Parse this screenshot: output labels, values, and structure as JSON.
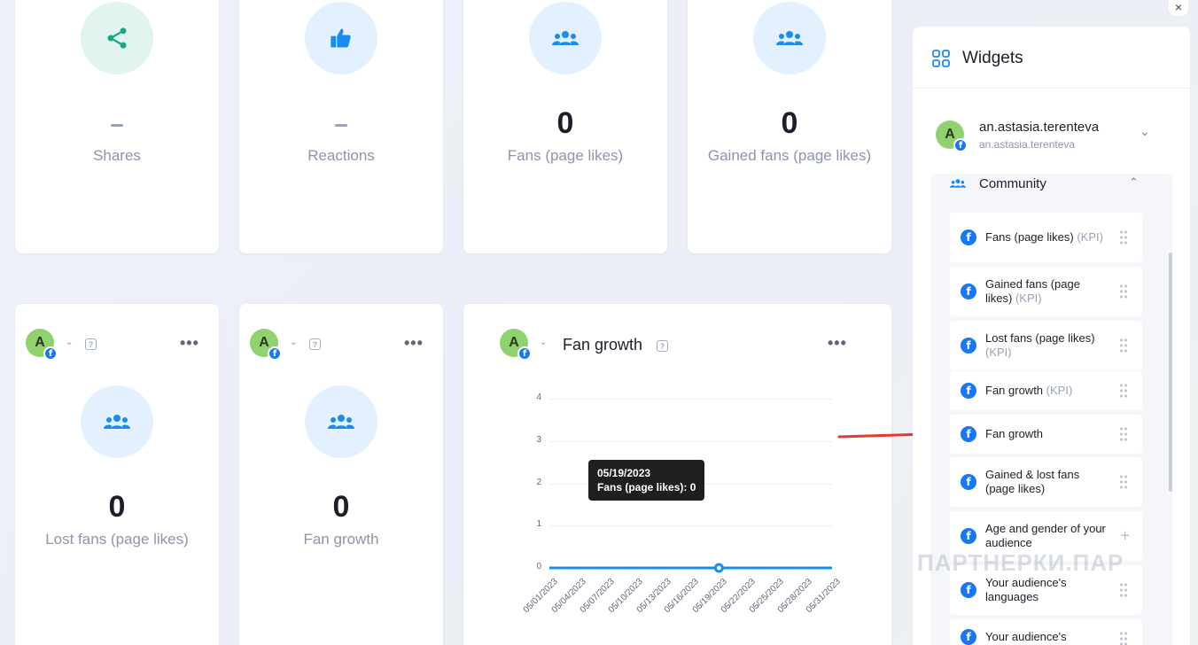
{
  "top_cards": [
    {
      "value": "",
      "label": "Shares",
      "icon": "share-icon",
      "empty": true
    },
    {
      "value": "",
      "label": "Reactions",
      "icon": "thumbs-up-icon",
      "empty": true
    },
    {
      "value": "0",
      "label": "Fans (page likes)",
      "icon": "users-icon",
      "empty": false
    },
    {
      "value": "0",
      "label": "Gained fans (page likes)",
      "icon": "users-icon",
      "empty": false
    }
  ],
  "bottom_cards": [
    {
      "avatar": "A",
      "value": "0",
      "label": "Lost fans (page likes)"
    },
    {
      "avatar": "A",
      "value": "0",
      "label": "Fan growth"
    }
  ],
  "chart_card": {
    "avatar": "A",
    "title": "Fan growth",
    "tooltip": {
      "date": "05/19/2023",
      "text": "Fans (page likes): 0"
    }
  },
  "chart_data": {
    "type": "line",
    "title": "Fan growth",
    "xlabel": "",
    "ylabel": "",
    "ylim": [
      0,
      4
    ],
    "y_ticks": [
      "4",
      "3",
      "2",
      "1",
      "0"
    ],
    "x_ticks": [
      "05/01/2023",
      "05/04/2023",
      "05/07/2023",
      "05/10/2023",
      "05/13/2023",
      "05/16/2023",
      "05/19/2023",
      "05/22/2023",
      "05/25/2023",
      "05/28/2023",
      "05/31/2023"
    ],
    "series": [
      {
        "name": "Fans (page likes)",
        "color": "#1a8cf0",
        "values": [
          0,
          0,
          0,
          0,
          0,
          0,
          0,
          0,
          0,
          0,
          0
        ]
      }
    ],
    "highlight": {
      "x": "05/19/2023",
      "y": 0
    },
    "grid": true
  },
  "panel": {
    "title": "Widgets",
    "account": {
      "avatar": "A",
      "name": "an.astasia.terenteva",
      "handle": "an.astasia.terenteva"
    },
    "section": "Community",
    "items": [
      {
        "label": "Fans (page likes)",
        "kpi": "(KPI)",
        "action": "drag"
      },
      {
        "label": "Gained fans (page likes)",
        "kpi": "(KPI)",
        "action": "drag"
      },
      {
        "label": "Lost fans (page likes)",
        "kpi": "(KPI)",
        "action": "drag"
      },
      {
        "label": "Fan growth",
        "kpi": "(KPI)",
        "action": "drag"
      },
      {
        "label": "Fan growth",
        "kpi": "",
        "action": "drag"
      },
      {
        "label": "Gained & lost fans (page likes)",
        "kpi": "",
        "action": "drag"
      },
      {
        "label": "Age and gender of your audience",
        "kpi": "",
        "action": "add"
      },
      {
        "label": "Your audience's languages",
        "kpi": "",
        "action": "drag"
      },
      {
        "label": "Your audience's",
        "kpi": "",
        "action": "drag"
      }
    ]
  },
  "close_label": "×",
  "watermark": "ПАРТНЕРКИ.ПАР",
  "colors": {
    "accent": "#1877f2",
    "teal": "#1aa87f",
    "line": "#1a8cf0",
    "arrow": "#e23b2e"
  }
}
